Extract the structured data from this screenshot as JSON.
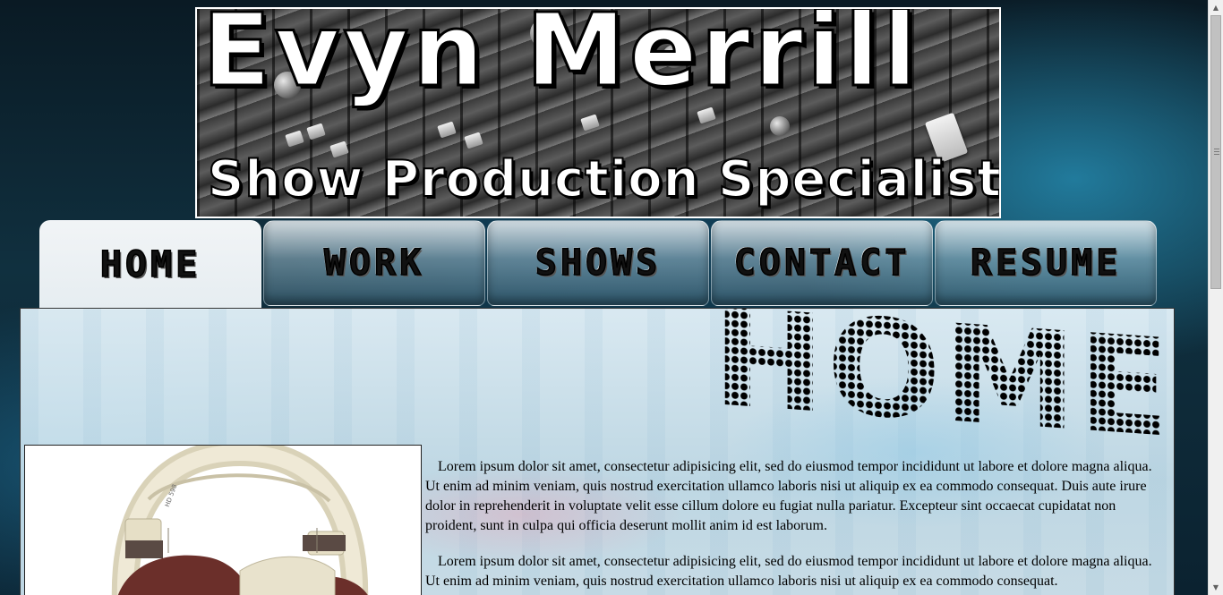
{
  "header": {
    "title": "Evyn Merrill",
    "subtitle": "Show Production Specialist"
  },
  "nav": {
    "tabs": [
      {
        "label": "HOME",
        "active": true
      },
      {
        "label": "WORK",
        "active": false
      },
      {
        "label": "SHOWS",
        "active": false
      },
      {
        "label": "CONTACT",
        "active": false
      },
      {
        "label": "RESUME",
        "active": false
      }
    ]
  },
  "main": {
    "heading": "HOME",
    "paragraphs": [
      "Lorem ipsum dolor sit amet, consectetur adipisicing elit, sed do eiusmod tempor incididunt ut labore et dolore magna aliqua. Ut enim ad minim veniam, quis nostrud exercitation ullamco laboris nisi ut aliquip ex ea commodo consequat. Duis aute irure dolor in reprehenderit in voluptate velit esse cillum dolore eu fugiat nulla pariatur. Excepteur sint occaecat cupidatat non proident, sunt in culpa qui officia deserunt mollit anim id est laborum.",
      "Lorem ipsum dolor sit amet, consectetur adipisicing elit, sed do eiusmod tempor incididunt ut labore et dolore magna aliqua. Ut enim ad minim veniam, quis nostrud exercitation ullamco laboris nisi ut aliquip ex ea commodo consequat."
    ],
    "photo": {
      "headphone_label": "HD 598"
    }
  },
  "colors": {
    "tab_text": "#111111",
    "content_bg": "#e1f0f8",
    "headphone_body": "#e8e2cc",
    "headphone_cushion": "#6b2f2a"
  }
}
